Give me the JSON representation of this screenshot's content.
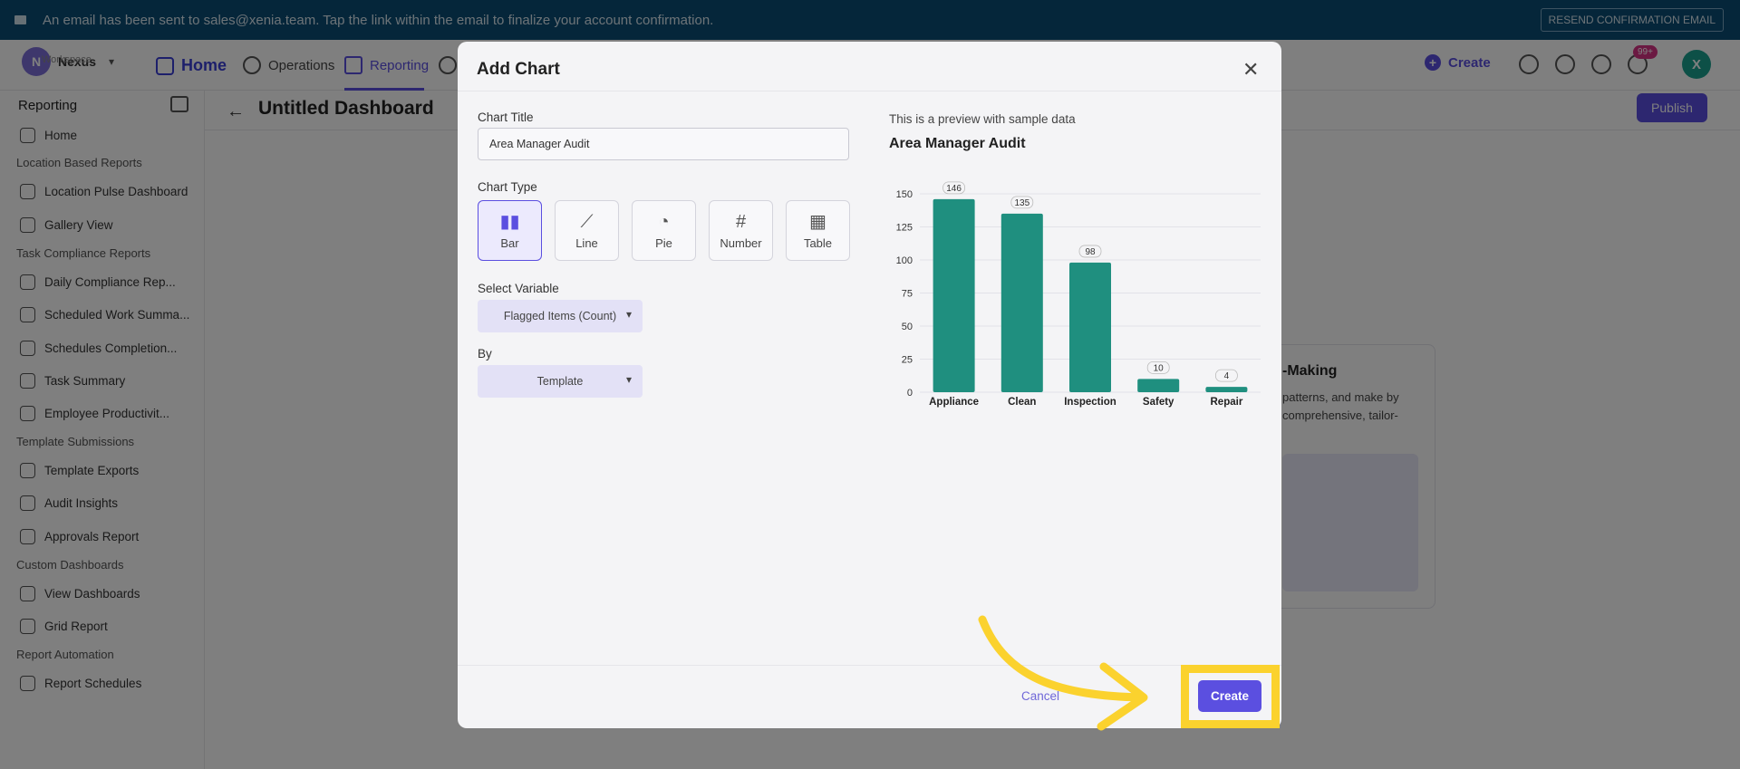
{
  "banner": {
    "message": "An email has been sent to sales@xenia.team. Tap the link within the email to finalize your account confirmation.",
    "resend_label": "RESEND CONFIRMATION EMAIL"
  },
  "topnav": {
    "workspace_label": "Workspace",
    "workspace_name": "Nexus",
    "workspace_initial": "N",
    "home": "Home",
    "operations": "Operations",
    "reporting": "Reporting",
    "create": "Create",
    "notif_badge": "99+",
    "user_initial": "X"
  },
  "sidebar": {
    "title": "Reporting",
    "items": [
      {
        "label": "Home",
        "icon": "home-icon"
      },
      {
        "label": "Location Based Reports",
        "section": true
      },
      {
        "label": "Location Pulse Dashboard",
        "icon": "pulse-icon"
      },
      {
        "label": "Gallery View",
        "icon": "image-icon"
      },
      {
        "label": "Task Compliance Reports",
        "section": true
      },
      {
        "label": "Daily Compliance Rep...",
        "icon": "clipboard-icon"
      },
      {
        "label": "Scheduled Work Summa...",
        "icon": "list-icon"
      },
      {
        "label": "Schedules Completion...",
        "icon": "refresh-icon"
      },
      {
        "label": "Task Summary",
        "icon": "document-icon"
      },
      {
        "label": "Employee Productivit...",
        "icon": "users-icon"
      },
      {
        "label": "Template Submissions",
        "section": true
      },
      {
        "label": "Template Exports",
        "icon": "table-icon"
      },
      {
        "label": "Audit Insights",
        "icon": "gauge-icon"
      },
      {
        "label": "Approvals Report",
        "icon": "check-circle-icon"
      },
      {
        "label": "Custom Dashboards",
        "section": true
      },
      {
        "label": "View Dashboards",
        "icon": "grid-icon"
      },
      {
        "label": "Grid Report",
        "icon": "hash-icon"
      },
      {
        "label": "Report Automation",
        "section": true
      },
      {
        "label": "Report Schedules",
        "icon": "calendar-icon"
      }
    ]
  },
  "main": {
    "title": "Untitled Dashboard",
    "publish": "Publish",
    "bg_card_heading": "-Making",
    "bg_card_text": "patterns, and make by comprehensive, tailor-"
  },
  "modal": {
    "title": "Add Chart",
    "chart_title_label": "Chart Title",
    "chart_title_value": "Area Manager Audit",
    "chart_type_label": "Chart Type",
    "chart_types": [
      {
        "label": "Bar",
        "icon": "bar-chart-icon",
        "selected": true
      },
      {
        "label": "Line",
        "icon": "line-chart-icon",
        "selected": false
      },
      {
        "label": "Pie",
        "icon": "pie-chart-icon",
        "selected": false
      },
      {
        "label": "Number",
        "icon": "hash-icon",
        "selected": false
      },
      {
        "label": "Table",
        "icon": "table-icon",
        "selected": false
      }
    ],
    "select_variable_label": "Select Variable",
    "select_variable_value": "Flagged Items (Count)",
    "by_label": "By",
    "by_value": "Template",
    "preview_note": "This is a preview with sample data",
    "preview_title": "Area Manager Audit",
    "cancel": "Cancel",
    "create": "Create"
  },
  "chart_data": {
    "type": "bar",
    "title": "Area Manager Audit",
    "categories": [
      "Appliance",
      "Clean",
      "Inspection",
      "Safety",
      "Repair"
    ],
    "values": [
      146,
      135,
      98,
      10,
      4
    ],
    "ylim": [
      0,
      150
    ],
    "yticks": [
      0,
      25,
      50,
      75,
      100,
      125,
      150
    ],
    "grid": true,
    "bar_color": "#1f8f7f"
  },
  "colors": {
    "accent": "#5b4fe0",
    "banner": "#0a4c74",
    "highlight": "#fbd22e"
  }
}
